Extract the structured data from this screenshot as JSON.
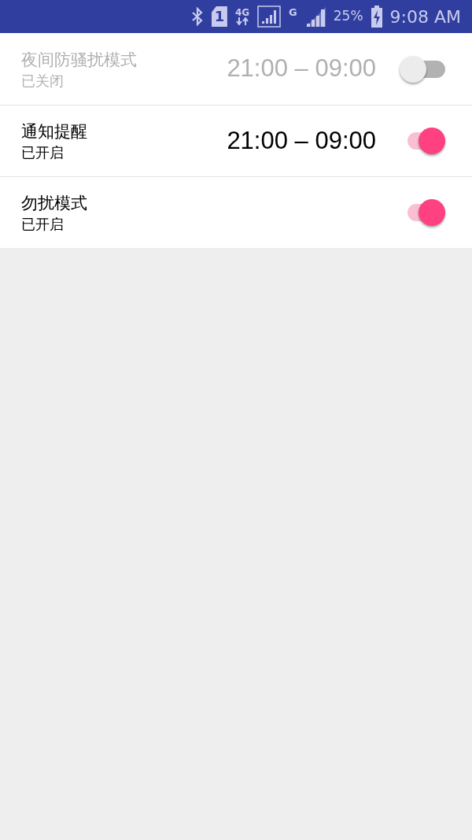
{
  "status_bar": {
    "sim_slot": "1",
    "network_1": "4G",
    "network_2": "G",
    "battery": "25%",
    "time": "9:08 AM"
  },
  "settings": [
    {
      "title": "夜间防骚扰模式",
      "status": "已关闭",
      "time_range": "21:00 – 09:00",
      "on": false
    },
    {
      "title": "通知提醒",
      "status": "已开启",
      "time_range": "21:00 – 09:00",
      "on": true
    },
    {
      "title": "勿扰模式",
      "status": "已开启",
      "on": true
    }
  ]
}
